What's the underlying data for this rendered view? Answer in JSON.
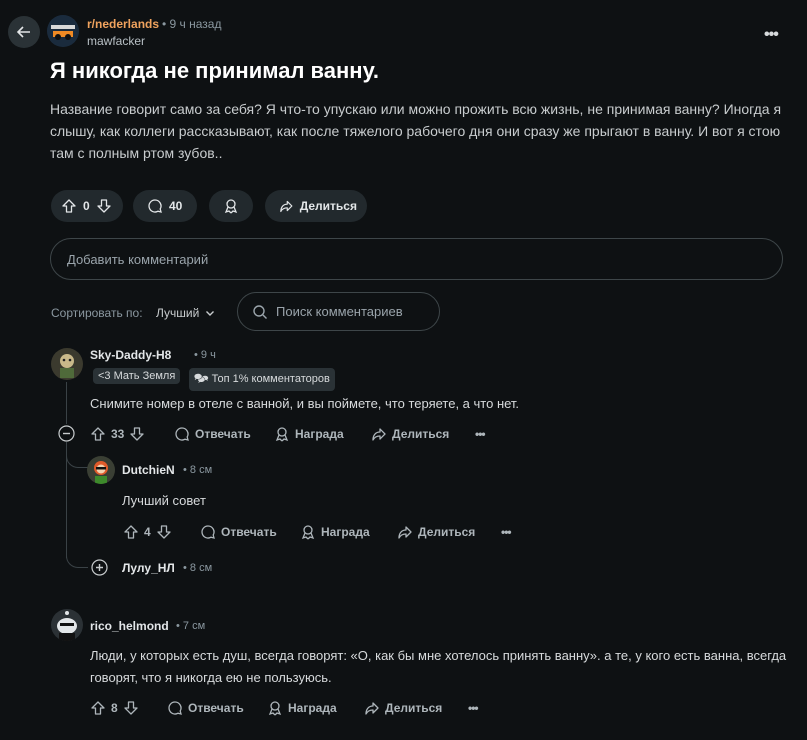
{
  "post": {
    "subreddit": "r/nederlands",
    "time": "• 9 ч назад",
    "author": "mawfacker",
    "title": "Я никогда не принимал ванну.",
    "body": "Название говорит само за себя? Я что-то упускаю или можно прожить всю жизнь, не принимая ванну? Иногда я слышу, как коллеги рассказывают, как после тяжелого рабочего дня они сразу же прыгают в ванну. И вот я стою там с полным ртом зубов..",
    "votes": "0",
    "comments": "40",
    "share_label": "Делиться",
    "more": "•••"
  },
  "composer": {
    "placeholder": "Добавить комментарий"
  },
  "sort": {
    "label": "Сортировать по:",
    "value": "Лучший"
  },
  "search": {
    "placeholder": "Поиск комментариев"
  },
  "actions": {
    "reply": "Отвечать",
    "award": "Награда",
    "share": "Делиться",
    "more": "•••"
  },
  "comments": [
    {
      "user": "Sky-Daddy-H8",
      "time": "• 9 ч",
      "flairs": [
        "<3 Мать Земля",
        "🗫 Топ 1% комментаторов"
      ],
      "text": "Снимите номер в отеле с ванной, и вы поймете, что теряете, а что нет.",
      "votes": "33"
    },
    {
      "user": "DutchieN",
      "time": "• 8 см",
      "text": "Лучший совет",
      "votes": "4"
    },
    {
      "user": "Лулу_НЛ",
      "time": "• 8 см"
    },
    {
      "user": "rico_helmond",
      "time": "• 7 см",
      "text": "Люди, у которых есть душ, всегда говорят: «О, как бы мне хотелось принять ванну». а те, у кого есть ванна, всегда говорят, что я никогда ею не пользуюсь.",
      "votes": "8"
    }
  ],
  "colors": {
    "background": "#0e1113",
    "subreddit": "#f0a35e",
    "pill": "#22292d"
  },
  "icons": [
    "back-arrow-icon",
    "upvote-icon",
    "downvote-icon",
    "comment-icon",
    "award-icon",
    "share-icon",
    "search-icon",
    "chevron-down-icon",
    "collapse-icon",
    "expand-icon"
  ]
}
